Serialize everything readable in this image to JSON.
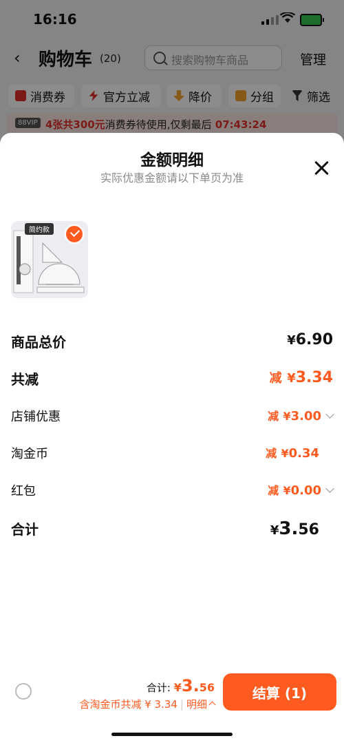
{
  "status_bar": {
    "time": "16:16"
  },
  "nav": {
    "back_icon": "chevron-left-icon",
    "title": "购物车",
    "count": "(20)",
    "search_placeholder": "搜索购物车商品",
    "manage": "管理"
  },
  "chips": [
    {
      "label": "消费券",
      "icon": "coupon-icon",
      "color": "#e2312b"
    },
    {
      "label": "官方立减",
      "icon": "lightning-icon",
      "color": "#e2312b"
    },
    {
      "label": "降价",
      "icon": "down-arrow-icon",
      "color": "#f2a22b"
    },
    {
      "label": "分组",
      "icon": "folder-icon",
      "color": "#f2a22b"
    },
    {
      "label": "筛选",
      "icon": "filter-icon",
      "color": "#333333"
    }
  ],
  "vip_bar": {
    "badge": "88VIP",
    "highlight": "4张共300元",
    "text": "消费券待使用,仅剩最后",
    "countdown": "07:43:24"
  },
  "sheet": {
    "title": "金额明细",
    "subtitle": "实际优惠金额请以下单页为准",
    "product": {
      "label": "简约款",
      "selected": true
    },
    "rows": {
      "total_label": "商品总价",
      "total_yen": "¥",
      "total_value": "6.90",
      "reduce_label": "共减",
      "reduce_prefix": "减",
      "reduce_yen": "¥",
      "reduce_value": "3.34",
      "shop_label": "店铺优惠",
      "shop_prefix": "减",
      "shop_yen": "¥",
      "shop_value": "3.00",
      "coin_label": "淘金币",
      "coin_prefix": "减",
      "coin_yen": "¥",
      "coin_value": "0.34",
      "redpack_label": "红包",
      "redpack_prefix": "减",
      "redpack_yen": "¥",
      "redpack_value": "0.00",
      "sum_label": "合计",
      "sum_yen": "¥",
      "sum_int": "3.",
      "sum_dec": "56"
    }
  },
  "footer": {
    "total_label": "合计:",
    "total_yen": "¥",
    "total_int": "3.",
    "total_dec": "56",
    "discount_text": "含淘金币共减 ¥ 3.34",
    "separator": "|",
    "detail_link": "明细",
    "checkout": "结算 (1)"
  },
  "colors": {
    "accent": "#ff5a1f",
    "red": "#e2312b"
  }
}
